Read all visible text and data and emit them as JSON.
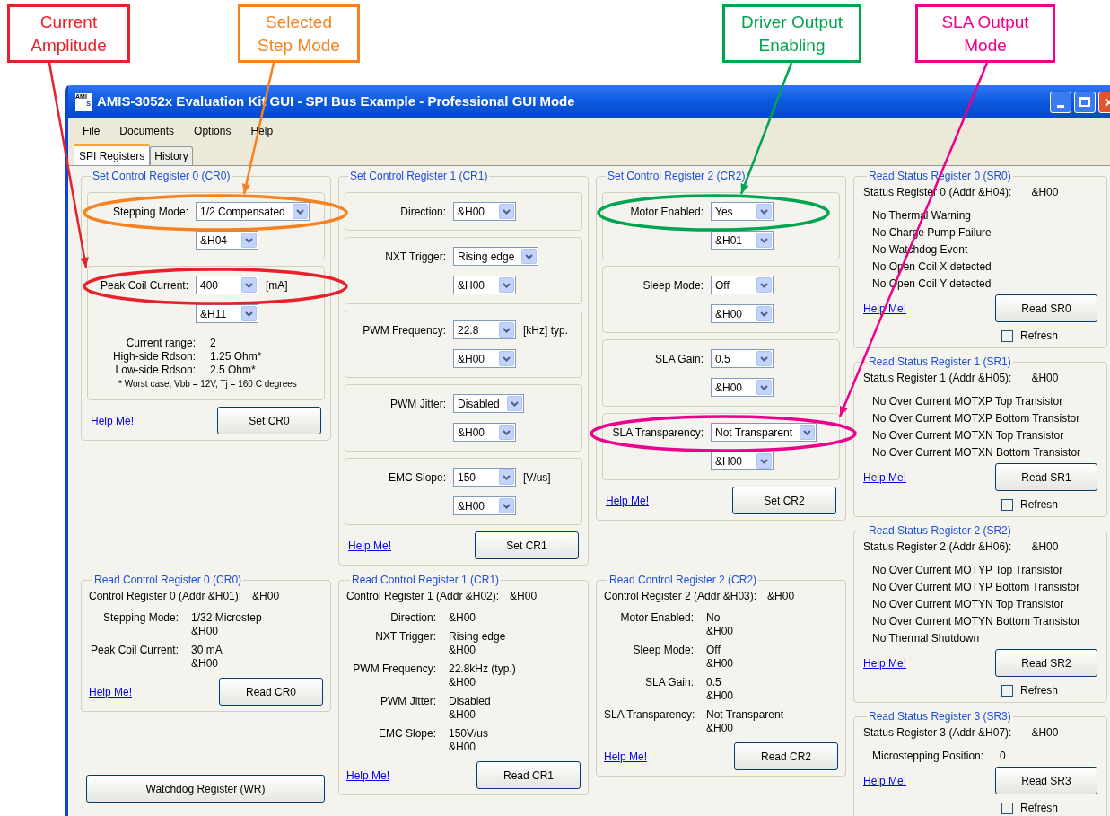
{
  "annotations": [
    {
      "label": "Current Amplitude",
      "color": "#e8202a"
    },
    {
      "label": "Selected Step Mode",
      "color": "#f5821f"
    },
    {
      "label": "Driver Output Enabling",
      "color": "#00a550"
    },
    {
      "label": "SLA Output Mode",
      "color": "#ec008c"
    }
  ],
  "window": {
    "title": "AMIS-3052x Evaluation Kit GUI - SPI Bus Example - Professional GUI Mode",
    "logo_top": "AMI",
    "logo_bottom": "S"
  },
  "menu": [
    "File",
    "Documents",
    "Options",
    "Help"
  ],
  "tabs": [
    {
      "label": "SPI Registers",
      "selected": true
    },
    {
      "label": "History",
      "selected": false
    }
  ],
  "set_registers": [
    {
      "title": "Set Control Register 0 (CR0)",
      "groups": [
        {
          "label": "Stepping Mode:",
          "value": "1/2 Compensated",
          "hex": "&H04"
        },
        {
          "label": "Peak Coil Current:",
          "value": "400",
          "unit": "[mA]",
          "hex": "&H11",
          "info": [
            {
              "label": "Current range:",
              "value": "2"
            },
            {
              "label": "High-side Rdson:",
              "value": "1.25 Ohm*"
            },
            {
              "label": "Low-side Rdson:",
              "value": "2.5 Ohm*"
            }
          ],
          "note": "* Worst case, Vbb = 12V, Tj = 160 C degrees"
        }
      ],
      "help": "Help Me!",
      "button": "Set CR0"
    },
    {
      "title": "Set Control Register 1 (CR1)",
      "groups": [
        {
          "label": "Direction:",
          "value": "&H00"
        },
        {
          "label": "NXT Trigger:",
          "value": "Rising edge",
          "hex": "&H00"
        },
        {
          "label": "PWM Frequency:",
          "value": "22.8",
          "unit": "[kHz] typ.",
          "hex": "&H00"
        },
        {
          "label": "PWM Jitter:",
          "value": "Disabled",
          "hex": "&H00"
        },
        {
          "label": "EMC Slope:",
          "value": "150",
          "unit": "[V/us]",
          "hex": "&H00"
        }
      ],
      "help": "Help Me!",
      "button": "Set CR1"
    },
    {
      "title": "Set Control Register 2 (CR2)",
      "groups": [
        {
          "label": "Motor Enabled:",
          "value": "Yes",
          "hex": "&H01"
        },
        {
          "label": "Sleep Mode:",
          "value": "Off",
          "hex": "&H00"
        },
        {
          "label": "SLA Gain:",
          "value": "0.5",
          "hex": "&H00"
        },
        {
          "label": "SLA Transparency:",
          "value": "Not Transparent",
          "hex": "&H00"
        }
      ],
      "help": "Help Me!",
      "button": "Set CR2"
    }
  ],
  "read_registers": [
    {
      "title": "Read Control Register 0 (CR0)",
      "header_label": "Control Register 0 (Addr &H01):",
      "header_value": "&H00",
      "rows": [
        {
          "label": "Stepping Mode:",
          "value": "1/32 Microstep",
          "hex": "&H00"
        },
        {
          "label": "Peak Coil Current:",
          "value": "30 mA",
          "hex": "&H00"
        }
      ],
      "help": "Help Me!",
      "button": "Read CR0"
    },
    {
      "title": "Read Control Register 1 (CR1)",
      "header_label": "Control Register 1 (Addr &H02):",
      "header_value": "&H00",
      "rows": [
        {
          "label": "Direction:",
          "value": "&H00"
        },
        {
          "label": "NXT Trigger:",
          "value": "Rising edge",
          "hex": "&H00"
        },
        {
          "label": "PWM Frequency:",
          "value": "22.8kHz (typ.)",
          "hex": "&H00"
        },
        {
          "label": "PWM Jitter:",
          "value": "Disabled",
          "hex": "&H00"
        },
        {
          "label": "EMC Slope:",
          "value": "150V/us",
          "hex": "&H00"
        }
      ],
      "help": "Help Me!",
      "button": "Read CR1"
    },
    {
      "title": "Read Control Register 2 (CR2)",
      "header_label": "Control Register 2 (Addr &H03):",
      "header_value": "&H00",
      "rows": [
        {
          "label": "Motor Enabled:",
          "value": "No",
          "hex": "&H00"
        },
        {
          "label": "Sleep Mode:",
          "value": "Off",
          "hex": "&H00"
        },
        {
          "label": "SLA Gain:",
          "value": "0.5",
          "hex": "&H00"
        },
        {
          "label": "SLA Transparency:",
          "value": "Not Transparent",
          "hex": "&H00"
        }
      ],
      "help": "Help Me!",
      "button": "Read CR2"
    }
  ],
  "watchdog_button": "Watchdog Register (WR)",
  "status_registers": [
    {
      "title": "Read Status Register 0 (SR0)",
      "header_label": "Status Register 0 (Addr &H04):",
      "header_value": "&H00",
      "lines": [
        {
          "text": "No Thermal Warning"
        },
        {
          "text": "No Charge Pump Failure"
        },
        {
          "text": "No Watchdog Event"
        },
        {
          "text": "No Open Coil X detected"
        },
        {
          "text": "No Open Coil Y detected"
        }
      ],
      "help": "Help Me!",
      "button": "Read SR0",
      "refresh": {
        "label": "Refresh",
        "checked": false
      }
    },
    {
      "title": "Read Status Register 1 (SR1)",
      "header_label": "Status Register 1 (Addr &H05):",
      "header_value": "&H00",
      "lines": [
        {
          "text": "No Over Current MOTXP Top Transistor"
        },
        {
          "text": "No Over Current MOTXP Bottom Transistor"
        },
        {
          "text": "No Over Current MOTXN Top Transistor"
        },
        {
          "text": "No Over Current MOTXN Bottom Transistor"
        }
      ],
      "help": "Help Me!",
      "button": "Read SR1",
      "refresh": {
        "label": "Refresh",
        "checked": false
      }
    },
    {
      "title": "Read Status Register 2 (SR2)",
      "header_label": "Status Register 2 (Addr &H06):",
      "header_value": "&H00",
      "lines": [
        {
          "text": "No Over Current MOTYP Top Transistor"
        },
        {
          "text": "No Over Current MOTYP Bottom Transistor"
        },
        {
          "text": "No Over Current MOTYN Top Transistor"
        },
        {
          "text": "No Over Current MOTYN Bottom Transistor"
        },
        {
          "text": "No Thermal Shutdown"
        }
      ],
      "help": "Help Me!",
      "button": "Read SR2",
      "refresh": {
        "label": "Refresh",
        "checked": false
      }
    },
    {
      "title": "Read Status Register 3 (SR3)",
      "header_label": "Status Register 3 (Addr &H07):",
      "header_value": "&H00",
      "lines": [
        {
          "text": "Microstepping Position:",
          "value": "0"
        }
      ],
      "help": "Help Me!",
      "button": "Read SR3",
      "refresh": {
        "label": "Refresh",
        "checked": false
      }
    }
  ]
}
